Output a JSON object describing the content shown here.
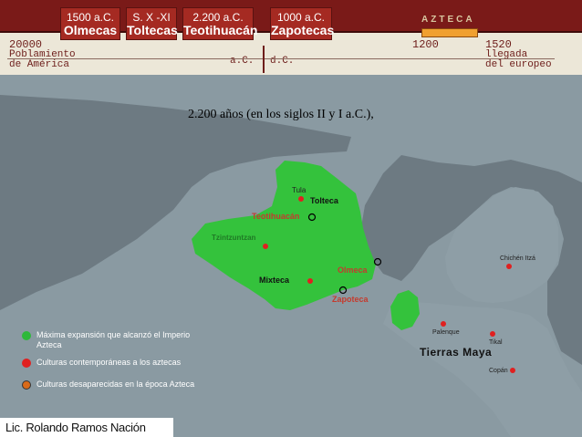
{
  "timeline": {
    "periods": [
      {
        "date": "1500 a.C.",
        "name": "Olmecas"
      },
      {
        "date": "S. X -XI",
        "name": "Toltecas"
      },
      {
        "date": "2.200 a.C.",
        "name": "Teotihuacán"
      },
      {
        "date": "1000 a.C.",
        "name": "Zapotecas"
      }
    ],
    "azteca_label": "AZTECA",
    "left_year": "20000",
    "left_caption_1": "Poblamiento",
    "left_caption_2": "de América",
    "ac": "a.C.",
    "dc": "d.C.",
    "year_1200": "1200",
    "year_1520": "1520",
    "right_caption_1": "llegada",
    "right_caption_2": "del europeo"
  },
  "title": "2.200 años (en los siglos II y I a.C.),",
  "map_labels": {
    "tula": "Tula",
    "tolteca": "Tolteca",
    "teotihuacan": "Teotihuacán",
    "tarasca": "Tzintzuntzan",
    "olmeca": "Olmeca",
    "mixteca": "Mixteca",
    "zapoteca": "Zapoteca",
    "chichen": "Chichén Itzá",
    "palenque": "Palenque",
    "tikal": "Tikal",
    "tierras_maya": "Tierras Maya",
    "copan": "Copán"
  },
  "legend": [
    {
      "text": "Máxima expansión que alcanzó el Imperio Azteca",
      "color": "#2eb83a"
    },
    {
      "text": "Culturas contemporáneas a los aztecas",
      "color": "#e02020"
    },
    {
      "text": "Culturas desaparecidas en la época Azteca",
      "color": "#d86a1a"
    }
  ],
  "credit": "Lic. Rolando Ramos Nación"
}
